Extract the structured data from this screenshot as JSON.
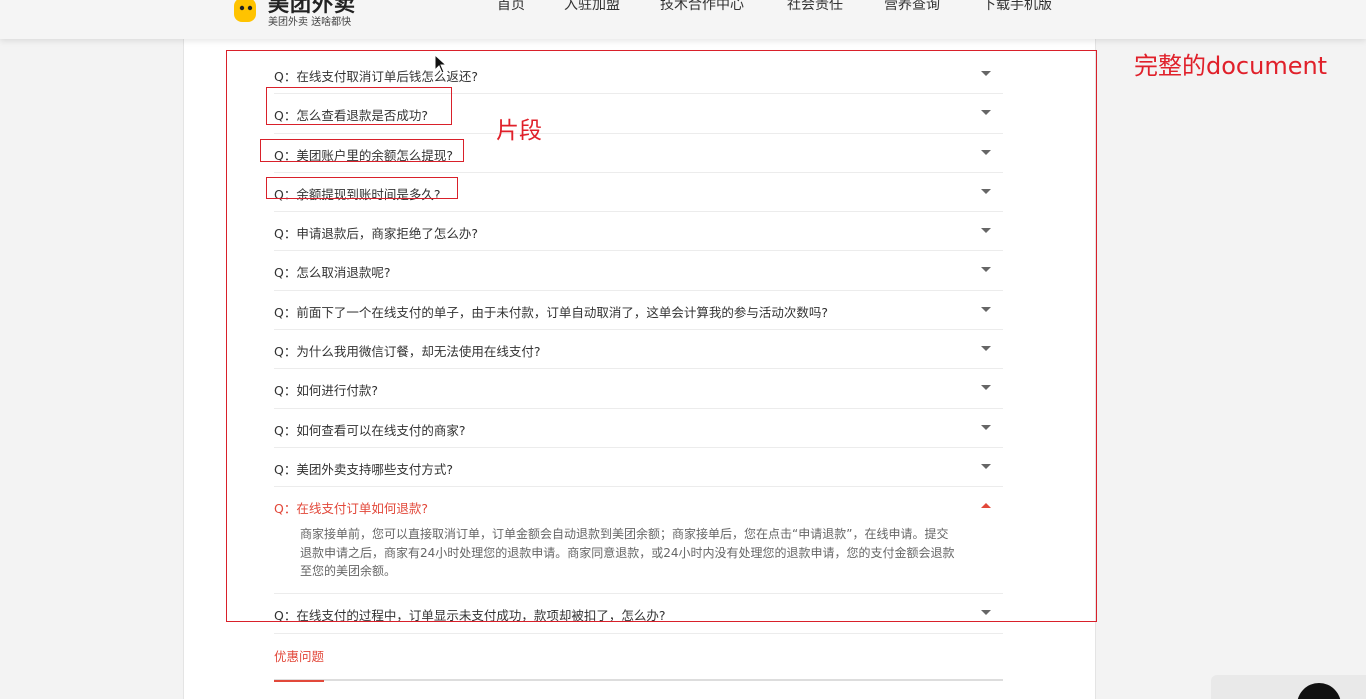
{
  "header": {
    "logo_title": "美团外卖",
    "logo_slogan": "美团外卖 送啥都快",
    "nav": [
      {
        "label": "首页"
      },
      {
        "label": "入驻加盟"
      },
      {
        "label": "技术合作中心"
      },
      {
        "label": "社会责任"
      },
      {
        "label": "营养查询"
      },
      {
        "label": "下载手机版"
      }
    ]
  },
  "faq": {
    "items": [
      {
        "question": "Q：在线支付取消订单后钱怎么返还?"
      },
      {
        "question": "Q：怎么查看退款是否成功?"
      },
      {
        "question": "Q：美团账户里的余额怎么提现?"
      },
      {
        "question": "Q：余额提现到账时间是多久?"
      },
      {
        "question": "Q：申请退款后，商家拒绝了怎么办?"
      },
      {
        "question": "Q：怎么取消退款呢?"
      },
      {
        "question": "Q：前面下了一个在线支付的单子，由于未付款，订单自动取消了，这单会计算我的参与活动次数吗?"
      },
      {
        "question": "Q：为什么我用微信订餐，却无法使用在线支付?"
      },
      {
        "question": "Q：如何进行付款?"
      },
      {
        "question": "Q：如何查看可以在线支付的商家?"
      },
      {
        "question": "Q：美团外卖支持哪些支付方式?"
      },
      {
        "question": "Q：在线支付订单如何退款?",
        "answer": "商家接单前，您可以直接取消订单，订单金额会自动退款到美团余额；商家接单后，您在点击“申请退款”，在线申请。提交退款申请之后，商家有24小时处理您的退款申请。商家同意退款，或24小时内没有处理您的退款申请，您的支付金额会退款至您的美团余额。"
      },
      {
        "question": "Q：在线支付的过程中，订单显示未支付成功，款项却被扣了，怎么办?"
      }
    ]
  },
  "tabs": {
    "active_label": "优惠问题"
  },
  "annotations": {
    "document_label": "完整的document",
    "fragment_label": "片段"
  },
  "colors": {
    "accent": "#e2483a",
    "annotation": "#d9202a",
    "logo_yellow": "#ffc300"
  }
}
